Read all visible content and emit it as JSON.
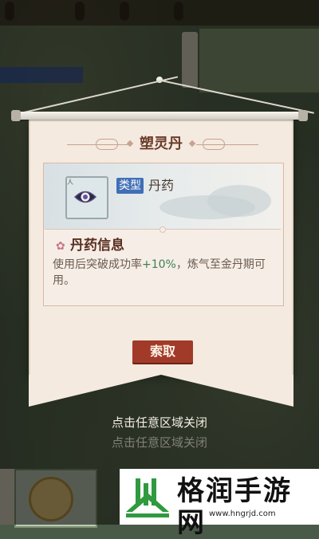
{
  "modal": {
    "title": "塑灵丹",
    "item": {
      "type_label": "类型",
      "type_value": "丹药",
      "icon": "eye-pill-icon"
    },
    "info": {
      "heading": "丹药信息",
      "desc_prefix": "使用后突破成功率",
      "desc_highlight": "+10%",
      "desc_suffix": "，炼气至金丹期可用。"
    },
    "claim_label": "索取",
    "close_hint": "点击任意区域关闭"
  },
  "watermark": {
    "title": "格润手游网",
    "url": "www.hngrjd.com"
  },
  "colors": {
    "panel": "#f4eadf",
    "title": "#6a3b2a",
    "type_badge": "#3f6fb6",
    "highlight": "#3f7f56",
    "claim_button": "#a13a28",
    "watermark_green": "#2f9a3e"
  }
}
